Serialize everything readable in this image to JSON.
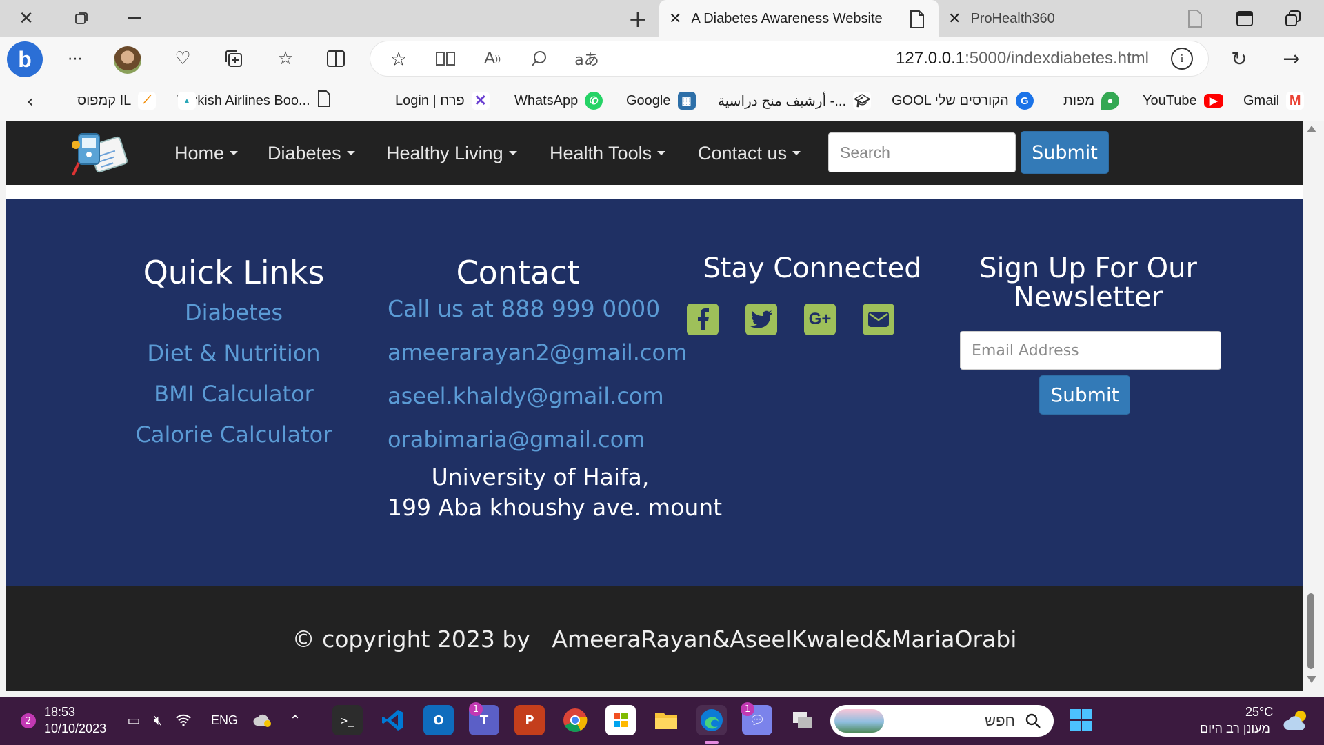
{
  "browser": {
    "tabs": [
      {
        "label": "A Diabetes Awareness Website"
      },
      {
        "label": "ProHealth360"
      }
    ],
    "url_host": "127.0.0.1",
    "url_path": ":5000/indexdiabetes.html",
    "bookmarks": [
      {
        "label": "Gmail",
        "icon": "gmail-icon"
      },
      {
        "label": "YouTube",
        "icon": "youtube-icon"
      },
      {
        "label": "מפות",
        "icon": "maps-icon"
      },
      {
        "label": "GOOL הקורסים שלי",
        "icon": "gool-icon"
      },
      {
        "label": "أرشيف منح دراسية -...",
        "icon": "graduation-cap-icon"
      },
      {
        "label": "Google",
        "icon": "google-icon"
      },
      {
        "label": "WhatsApp",
        "icon": "whatsapp-icon"
      },
      {
        "label": "Login | פרח",
        "icon": "perach-icon"
      },
      {
        "label": "Turkish Airlines Boo...",
        "icon": "page-icon"
      },
      {
        "label": "",
        "icon": "logo-icon"
      },
      {
        "label": "קמפוס IL",
        "icon": "campus-icon"
      }
    ]
  },
  "site": {
    "nav": [
      {
        "label": "Home"
      },
      {
        "label": "Diabetes"
      },
      {
        "label": "Healthy Living"
      },
      {
        "label": "Health Tools"
      },
      {
        "label": "Contact us"
      }
    ],
    "search_placeholder": "Search",
    "submit_label": "Submit",
    "footer": {
      "quick_links": {
        "title": "Quick Links",
        "items": [
          "Diabetes",
          "Diet & Nutrition",
          "BMI Calculator",
          "Calorie Calculator"
        ]
      },
      "contact": {
        "title": "Contact",
        "phone": "Call us at 888 999 0000",
        "emails": [
          "ameerarayan2@gmail.com",
          "aseel.khaldy@gmail.com",
          "orabimaria@gmail.com"
        ],
        "address_line1": "University of Haifa,",
        "address_line2": "199 Aba khoushy ave. mount"
      },
      "social": {
        "title": "Stay Connected",
        "icons": [
          "facebook-icon",
          "twitter-icon",
          "google-plus-icon",
          "envelope-icon"
        ],
        "color": "#9ec05a"
      },
      "newsletter": {
        "title_line1": "Sign Up For Our",
        "title_line2": "Newsletter",
        "email_placeholder": "Email Address",
        "submit_label": "Submit"
      }
    },
    "copyright": "© copyright 2023 by   AmeeraRayan&AseelKwaled&MariaOrabi",
    "colors": {
      "navbar": "#222222",
      "footer": "#1f3064",
      "link": "#5b9bd5",
      "button": "#337ab7"
    }
  },
  "taskbar": {
    "notification_count": "2",
    "time": "18:53",
    "date": "10/10/2023",
    "language": "ENG",
    "search_placeholder": "חפש",
    "temperature": "25°C",
    "weather": "מעונן רב היום",
    "teams_badge": "1",
    "chat_badge": "1"
  }
}
